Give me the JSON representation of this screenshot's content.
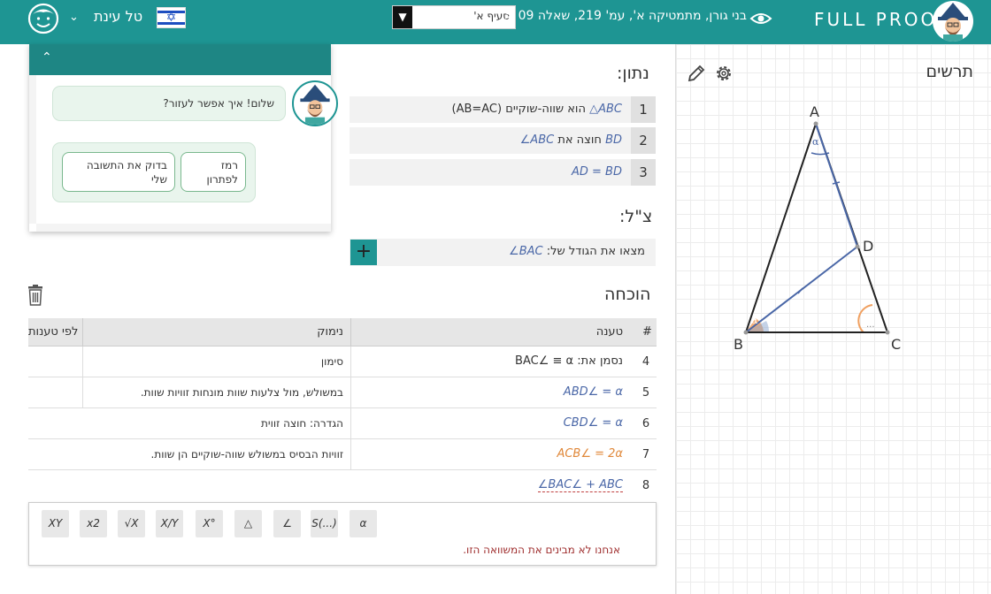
{
  "header": {
    "logo_text": "FULL PROOF",
    "breadcrumb": "בני גורן, מתמטיקה א', עמ' 219, שאלה 09",
    "breadcrumb_chevron": "<",
    "section_select": "סעיף א'",
    "user_name": "טל עינת",
    "colors": {
      "bar": "#1e9593"
    }
  },
  "given": {
    "title": "נתון:",
    "rows": [
      {
        "num": "1",
        "math": "ABC△",
        "text": " הוא שווה-שוקיים (AB=AC)"
      },
      {
        "num": "2",
        "math": "BD",
        "text": " חוצה את ",
        "math2": "ABC∠"
      },
      {
        "num": "3",
        "math": "AD = BD",
        "text": ""
      }
    ]
  },
  "goal": {
    "title": "צ\"ל:",
    "text": "מצאו את הגודל של: ",
    "math": "BAC∠",
    "plus": "+"
  },
  "proof": {
    "title": "הוכחה",
    "headers": {
      "num": "#",
      "claim": "טענה",
      "reason": "נימוק",
      "by": "לפי טענות"
    },
    "rows": [
      {
        "num": "4",
        "claim": "נסמן את: BAC∠ ≡ α",
        "reason": "סימון"
      },
      {
        "num": "5",
        "claim": "ABD∠ = α",
        "reason": "במשולש, מול צלעות שוות מונחות זוויות שוות."
      },
      {
        "num": "6",
        "claim": "CBD∠ = α",
        "reason": "הגדרה: חוצה זווית"
      },
      {
        "num": "7",
        "claim": "ACB∠ = 2α",
        "reason": "זוויות הבסיס במשולש שווה-שוקיים הן שוות."
      },
      {
        "num": "8",
        "claim": "BAC∠ + ABC∠",
        "reason": ""
      }
    ]
  },
  "editor": {
    "buttons": [
      "XY",
      "x2",
      "√X",
      "X/Y",
      "X°",
      "△",
      "∠",
      "S(...)",
      "α"
    ],
    "error": "אנחנו לא מבינים את המשוואה הזו."
  },
  "chat": {
    "greeting": "שלום! איך אפשר לעזור?",
    "options": [
      "רמז לפתרון",
      "בדוק את התשובה שלי"
    ]
  },
  "drawings": {
    "title": "תרשים",
    "labels": {
      "A": "A",
      "B": "B",
      "C": "C",
      "D": "D",
      "alpha": "α",
      "dots": "..."
    }
  }
}
